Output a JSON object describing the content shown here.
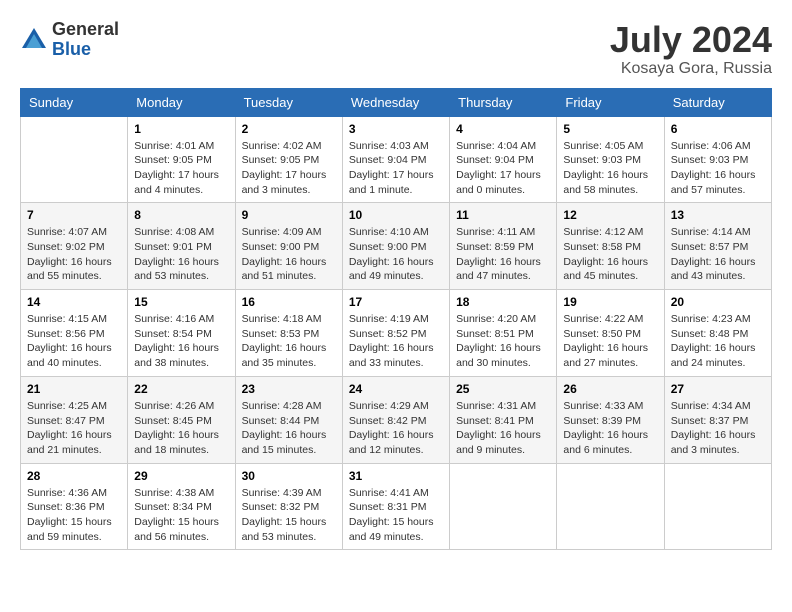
{
  "header": {
    "logo": {
      "general": "General",
      "blue": "Blue"
    },
    "title": "July 2024",
    "location": "Kosaya Gora, Russia"
  },
  "calendar": {
    "weekdays": [
      "Sunday",
      "Monday",
      "Tuesday",
      "Wednesday",
      "Thursday",
      "Friday",
      "Saturday"
    ],
    "weeks": [
      [
        {
          "day": "",
          "content": ""
        },
        {
          "day": "1",
          "content": "Sunrise: 4:01 AM\nSunset: 9:05 PM\nDaylight: 17 hours\nand 4 minutes."
        },
        {
          "day": "2",
          "content": "Sunrise: 4:02 AM\nSunset: 9:05 PM\nDaylight: 17 hours\nand 3 minutes."
        },
        {
          "day": "3",
          "content": "Sunrise: 4:03 AM\nSunset: 9:04 PM\nDaylight: 17 hours\nand 1 minute."
        },
        {
          "day": "4",
          "content": "Sunrise: 4:04 AM\nSunset: 9:04 PM\nDaylight: 17 hours\nand 0 minutes."
        },
        {
          "day": "5",
          "content": "Sunrise: 4:05 AM\nSunset: 9:03 PM\nDaylight: 16 hours\nand 58 minutes."
        },
        {
          "day": "6",
          "content": "Sunrise: 4:06 AM\nSunset: 9:03 PM\nDaylight: 16 hours\nand 57 minutes."
        }
      ],
      [
        {
          "day": "7",
          "content": "Sunrise: 4:07 AM\nSunset: 9:02 PM\nDaylight: 16 hours\nand 55 minutes."
        },
        {
          "day": "8",
          "content": "Sunrise: 4:08 AM\nSunset: 9:01 PM\nDaylight: 16 hours\nand 53 minutes."
        },
        {
          "day": "9",
          "content": "Sunrise: 4:09 AM\nSunset: 9:00 PM\nDaylight: 16 hours\nand 51 minutes."
        },
        {
          "day": "10",
          "content": "Sunrise: 4:10 AM\nSunset: 9:00 PM\nDaylight: 16 hours\nand 49 minutes."
        },
        {
          "day": "11",
          "content": "Sunrise: 4:11 AM\nSunset: 8:59 PM\nDaylight: 16 hours\nand 47 minutes."
        },
        {
          "day": "12",
          "content": "Sunrise: 4:12 AM\nSunset: 8:58 PM\nDaylight: 16 hours\nand 45 minutes."
        },
        {
          "day": "13",
          "content": "Sunrise: 4:14 AM\nSunset: 8:57 PM\nDaylight: 16 hours\nand 43 minutes."
        }
      ],
      [
        {
          "day": "14",
          "content": "Sunrise: 4:15 AM\nSunset: 8:56 PM\nDaylight: 16 hours\nand 40 minutes."
        },
        {
          "day": "15",
          "content": "Sunrise: 4:16 AM\nSunset: 8:54 PM\nDaylight: 16 hours\nand 38 minutes."
        },
        {
          "day": "16",
          "content": "Sunrise: 4:18 AM\nSunset: 8:53 PM\nDaylight: 16 hours\nand 35 minutes."
        },
        {
          "day": "17",
          "content": "Sunrise: 4:19 AM\nSunset: 8:52 PM\nDaylight: 16 hours\nand 33 minutes."
        },
        {
          "day": "18",
          "content": "Sunrise: 4:20 AM\nSunset: 8:51 PM\nDaylight: 16 hours\nand 30 minutes."
        },
        {
          "day": "19",
          "content": "Sunrise: 4:22 AM\nSunset: 8:50 PM\nDaylight: 16 hours\nand 27 minutes."
        },
        {
          "day": "20",
          "content": "Sunrise: 4:23 AM\nSunset: 8:48 PM\nDaylight: 16 hours\nand 24 minutes."
        }
      ],
      [
        {
          "day": "21",
          "content": "Sunrise: 4:25 AM\nSunset: 8:47 PM\nDaylight: 16 hours\nand 21 minutes."
        },
        {
          "day": "22",
          "content": "Sunrise: 4:26 AM\nSunset: 8:45 PM\nDaylight: 16 hours\nand 18 minutes."
        },
        {
          "day": "23",
          "content": "Sunrise: 4:28 AM\nSunset: 8:44 PM\nDaylight: 16 hours\nand 15 minutes."
        },
        {
          "day": "24",
          "content": "Sunrise: 4:29 AM\nSunset: 8:42 PM\nDaylight: 16 hours\nand 12 minutes."
        },
        {
          "day": "25",
          "content": "Sunrise: 4:31 AM\nSunset: 8:41 PM\nDaylight: 16 hours\nand 9 minutes."
        },
        {
          "day": "26",
          "content": "Sunrise: 4:33 AM\nSunset: 8:39 PM\nDaylight: 16 hours\nand 6 minutes."
        },
        {
          "day": "27",
          "content": "Sunrise: 4:34 AM\nSunset: 8:37 PM\nDaylight: 16 hours\nand 3 minutes."
        }
      ],
      [
        {
          "day": "28",
          "content": "Sunrise: 4:36 AM\nSunset: 8:36 PM\nDaylight: 15 hours\nand 59 minutes."
        },
        {
          "day": "29",
          "content": "Sunrise: 4:38 AM\nSunset: 8:34 PM\nDaylight: 15 hours\nand 56 minutes."
        },
        {
          "day": "30",
          "content": "Sunrise: 4:39 AM\nSunset: 8:32 PM\nDaylight: 15 hours\nand 53 minutes."
        },
        {
          "day": "31",
          "content": "Sunrise: 4:41 AM\nSunset: 8:31 PM\nDaylight: 15 hours\nand 49 minutes."
        },
        {
          "day": "",
          "content": ""
        },
        {
          "day": "",
          "content": ""
        },
        {
          "day": "",
          "content": ""
        }
      ]
    ]
  }
}
